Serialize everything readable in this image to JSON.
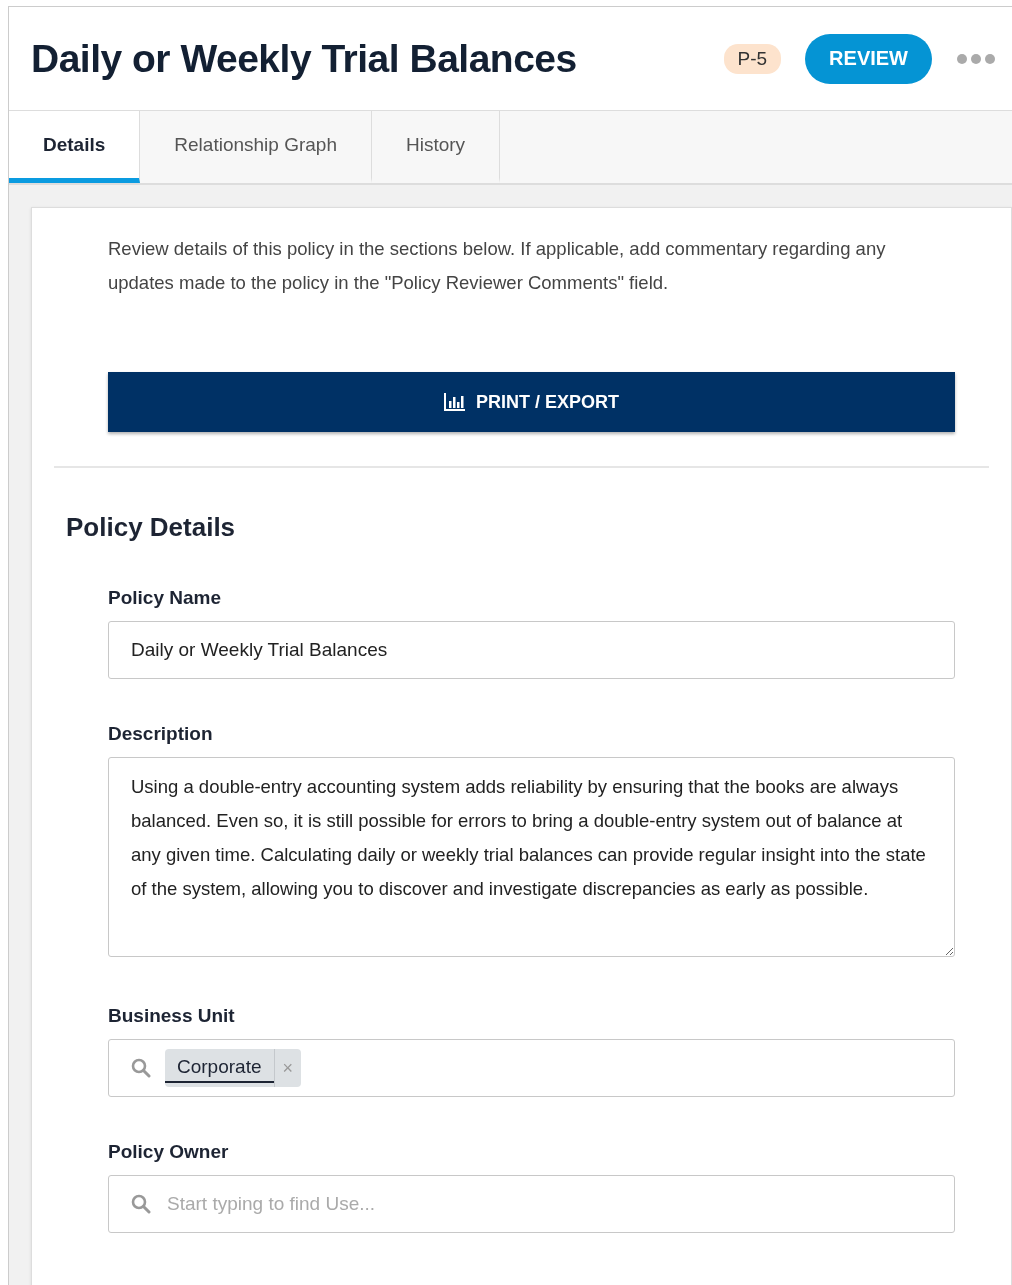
{
  "header": {
    "title": "Daily or Weekly Trial Balances",
    "badge": "P-5",
    "action": "REVIEW"
  },
  "tabs": [
    {
      "label": "Details",
      "selected": true
    },
    {
      "label": "Relationship Graph",
      "selected": false
    },
    {
      "label": "History",
      "selected": false
    }
  ],
  "intro": "Review details of this policy in the sections below. If applicable, add commentary regarding any updates made to the policy in the \"Policy Reviewer Comments\" field.",
  "print_button": "PRINT / EXPORT",
  "section": {
    "title": "Policy Details",
    "fields": [
      {
        "kind": "text",
        "label": "Policy Name",
        "value": "Daily or Weekly Trial Balances"
      },
      {
        "kind": "textarea",
        "label": "Description",
        "value": "Using a double-entry accounting system adds reliability by ensuring that the books are always balanced. Even so, it is still possible for errors to bring a double-entry system out of balance at any given time. Calculating daily or weekly trial balances can provide regular insight into the state of the system, allowing you to discover and investigate discrepancies as early as possible."
      },
      {
        "kind": "tags",
        "label": "Business Unit",
        "tags": [
          {
            "text": "Corporate",
            "remove": "×"
          }
        ]
      },
      {
        "kind": "lookup",
        "label": "Policy Owner",
        "placeholder": "Start typing to find Use..."
      }
    ]
  }
}
